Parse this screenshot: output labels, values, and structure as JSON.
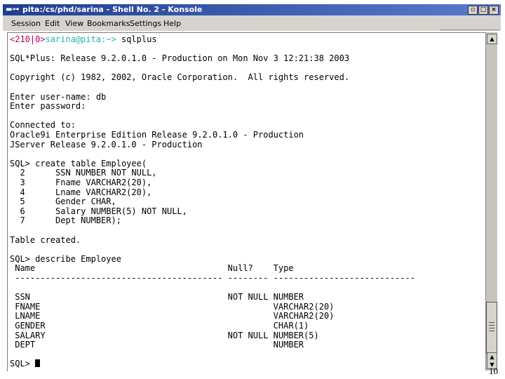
{
  "window": {
    "title": "pita:/cs/phd/sarina - Shell No. 2 - Konsole",
    "title_icon": "terminal-icon",
    "buttons": [
      "▫",
      "□",
      "×"
    ]
  },
  "menu": [
    "Session",
    "Edit",
    "View",
    "Bookmarks",
    "Settings",
    "Help"
  ],
  "prompt": {
    "ret": "<210|0>",
    "user": "sarina@pita",
    "path": ":~>",
    "command": " sqlplus"
  },
  "terminal_lines": [
    "",
    "SQL*Plus: Release 9.2.0.1.0 - Production on Mon Nov 3 12:21:38 2003",
    "",
    "Copyright (c) 1982, 2002, Oracle Corporation.  All rights reserved.",
    "",
    "Enter user-name: db",
    "Enter password:",
    "",
    "Connected to:",
    "Oracle9i Enterprise Edition Release 9.2.0.1.0 - Production",
    "JServer Release 9.2.0.1.0 - Production",
    "",
    "SQL> create table Employee(",
    "  2      SSN NUMBER NOT NULL,",
    "  3      Fname VARCHAR2(20),",
    "  4      Lname VARCHAR2(20),",
    "  5      Gender CHAR,",
    "  6      Salary NUMBER(5) NOT NULL,",
    "  7      Dept NUMBER);",
    "",
    "Table created.",
    "",
    "SQL> describe Employee",
    " Name                                      Null?    Type",
    " ----------------------------------------- -------- ----------------------------",
    "",
    " SSN                                       NOT NULL NUMBER",
    " FNAME                                              VARCHAR2(20)",
    " LNAME                                              VARCHAR2(20)",
    " GENDER                                             CHAR(1)",
    " SALARY                                    NOT NULL NUMBER(5)",
    " DEPT                                               NUMBER",
    ""
  ],
  "final_prompt": "SQL> ",
  "page_number": "10"
}
